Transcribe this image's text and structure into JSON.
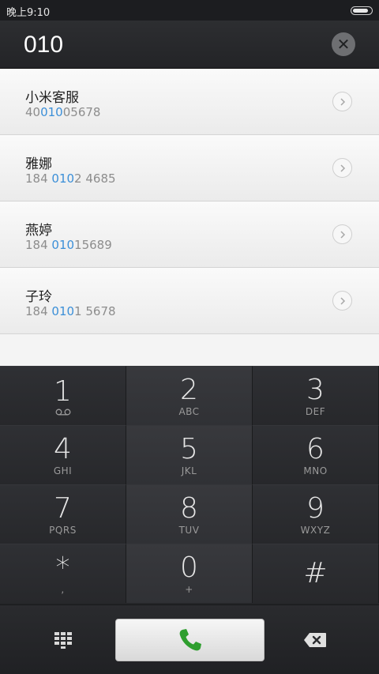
{
  "status_bar": {
    "time": "晚上9:10",
    "battery_level": 0.85
  },
  "search": {
    "query": "010",
    "clear_icon": "close-circle-icon"
  },
  "results": [
    {
      "name": "小米客服",
      "number_parts": [
        "40",
        "010",
        "05678"
      ]
    },
    {
      "name": "雅娜",
      "number_parts": [
        "184 ",
        "010",
        "2 4685"
      ]
    },
    {
      "name": "燕婷",
      "number_parts": [
        "184 ",
        "010",
        "15689"
      ]
    },
    {
      "name": "子玲",
      "number_parts": [
        "184 ",
        "010",
        "1 5678"
      ]
    }
  ],
  "keypad": {
    "keys": [
      {
        "digit": "1",
        "letters": ""
      },
      {
        "digit": "2",
        "letters": "ABC"
      },
      {
        "digit": "3",
        "letters": "DEF"
      },
      {
        "digit": "4",
        "letters": "GHI"
      },
      {
        "digit": "5",
        "letters": "JKL"
      },
      {
        "digit": "6",
        "letters": "MNO"
      },
      {
        "digit": "7",
        "letters": "PQRS"
      },
      {
        "digit": "8",
        "letters": "TUV"
      },
      {
        "digit": "9",
        "letters": "WXYZ"
      },
      {
        "digit": "*",
        "letters": ","
      },
      {
        "digit": "0",
        "letters": "+"
      },
      {
        "digit": "#",
        "letters": ""
      }
    ]
  },
  "bottom_bar": {
    "dialpad_icon": "dialpad-grid-icon",
    "call_icon": "phone-icon",
    "backspace_icon": "backspace-icon"
  },
  "colors": {
    "highlight": "#3b8fd8",
    "call_green": "#2e9e2e"
  }
}
